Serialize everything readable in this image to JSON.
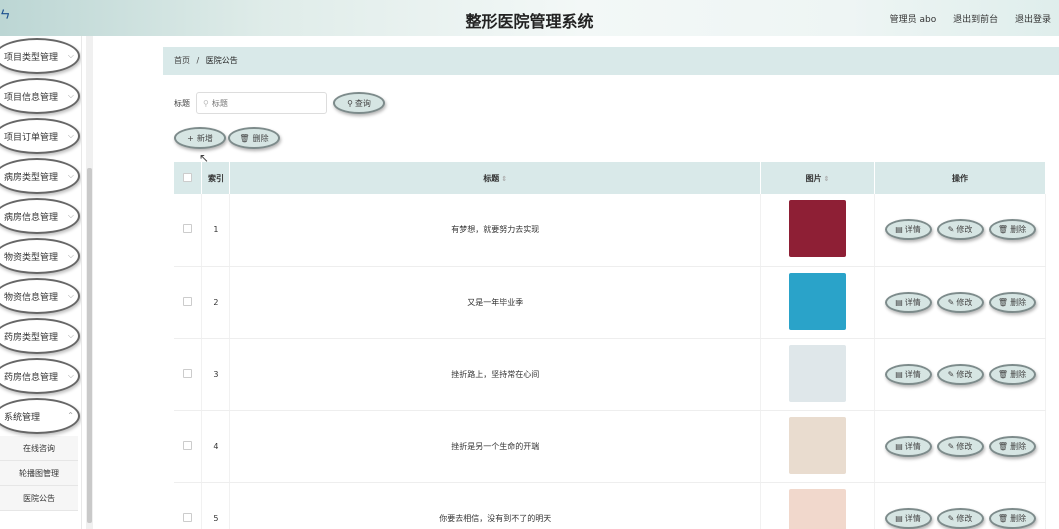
{
  "header": {
    "logo_text": "ㄣ",
    "title": "整形医院管理系统",
    "user": "管理员 abo",
    "front_link": "退出到前台",
    "logout_link": "退出登录"
  },
  "sidebar": {
    "items": [
      {
        "label": "项目类型管理"
      },
      {
        "label": "项目信息管理"
      },
      {
        "label": "项目订单管理"
      },
      {
        "label": "病房类型管理"
      },
      {
        "label": "病房信息管理"
      },
      {
        "label": "物资类型管理"
      },
      {
        "label": "物资信息管理"
      },
      {
        "label": "药房类型管理"
      },
      {
        "label": "药房信息管理"
      },
      {
        "label": "系统管理"
      }
    ],
    "subitems": [
      {
        "label": "在线咨询"
      },
      {
        "label": "轮播图管理"
      },
      {
        "label": "医院公告"
      }
    ]
  },
  "breadcrumb": {
    "home": "首页",
    "sep": "/",
    "current": "医院公告"
  },
  "search": {
    "label": "标题",
    "placeholder": "标题",
    "button": "查询"
  },
  "actions": {
    "add": "新增",
    "delete": "删除"
  },
  "table": {
    "headers": {
      "index": "索引",
      "title": "标题",
      "image": "图片",
      "ops": "操作"
    },
    "op_labels": {
      "detail": "详情",
      "edit": "修改",
      "delete": "删除"
    },
    "rows": [
      {
        "index": "1",
        "title": "有梦想，就要努力去实现",
        "image_color": "#8e1f35"
      },
      {
        "index": "2",
        "title": "又是一年毕业季",
        "image_color": "#2aa3c9"
      },
      {
        "index": "3",
        "title": "挫折路上，坚持常在心间",
        "image_color": "#dfe7ea"
      },
      {
        "index": "4",
        "title": "挫折是另一个生命的开端",
        "image_color": "#e9dccf"
      },
      {
        "index": "5",
        "title": "你要去相信，没有到不了的明天",
        "image_color": "#f1d8cc"
      }
    ]
  }
}
